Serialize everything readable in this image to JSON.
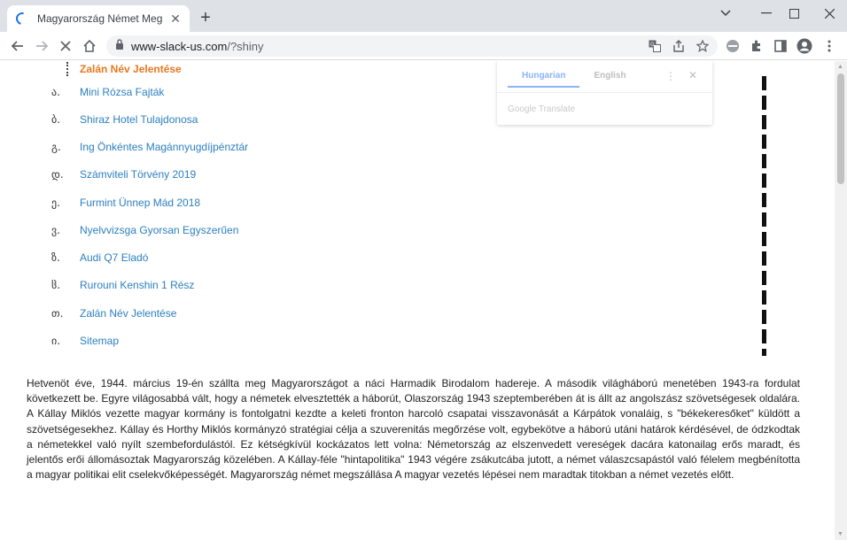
{
  "browser": {
    "tab_title": "Magyarország Német Megszállás",
    "url_host": "www-slack-us.com",
    "url_path": "/?shiny"
  },
  "page": {
    "current_item": "Zalán Név Jelentése",
    "list": [
      {
        "marker": "ა.",
        "label": "Mini Rózsa Fajták"
      },
      {
        "marker": "ბ.",
        "label": "Shiraz Hotel Tulajdonosa"
      },
      {
        "marker": "გ.",
        "label": "Ing Önkéntes Magánnyugdíjpénztár"
      },
      {
        "marker": "დ.",
        "label": "Számviteli Törvény 2019"
      },
      {
        "marker": "ე.",
        "label": "Furmint Ünnep Mád 2018"
      },
      {
        "marker": "ვ.",
        "label": "Nyelvvizsga Gyorsan Egyszerűen"
      },
      {
        "marker": "ზ.",
        "label": "Audi Q7 Eladó"
      },
      {
        "marker": "ჱ.",
        "label": "Rurouni Kenshin 1 Rész"
      },
      {
        "marker": "თ.",
        "label": "Zalán Név Jelentése"
      },
      {
        "marker": "ი.",
        "label": "Sitemap"
      }
    ],
    "article": "Hetvenöt éve, 1944. március 19-én szállta meg Magyarországot a náci Harmadik Birodalom hadereje. A második világháború menetében 1943-ra fordulat következett be. Egyre világosabbá vált, hogy a németek elvesztették a háborút, Olaszország 1943 szeptemberében át is állt az angolszász szövetségesek oldalára. A Kállay Miklós vezette magyar kormány is fontolgatni kezdte a keleti fronton harcoló csapatai visszavonását a Kárpátok vonaláig, s \"békekeresőket\" küldött a szövetségesekhez. Kállay és Horthy Miklós kormányzó stratégiai célja a szuverenitás megőrzése volt, egybekötve a háború utáni határok kérdésével, de ódzkodtak a németekkel való nyílt szembefordulástól. Ez kétségkívül kockázatos lett volna: Németország az elszenvedett vereségek dacára katonailag erős maradt, és jelentős erői állomásoztak Magyarország közelében. A Kállay-féle \"hintapolitika\" 1943 végére zsákutcába jutott, a német válaszcsapástól való félelem megbénította a magyar politikai elit cselekvőképességét. Magyarország német megszállása A magyar vezetés lépései nem maradtak titokban a német vezetés előtt."
  },
  "translate": {
    "lang_source": "Hungarian",
    "lang_target": "English",
    "brand": "Google Translate"
  }
}
